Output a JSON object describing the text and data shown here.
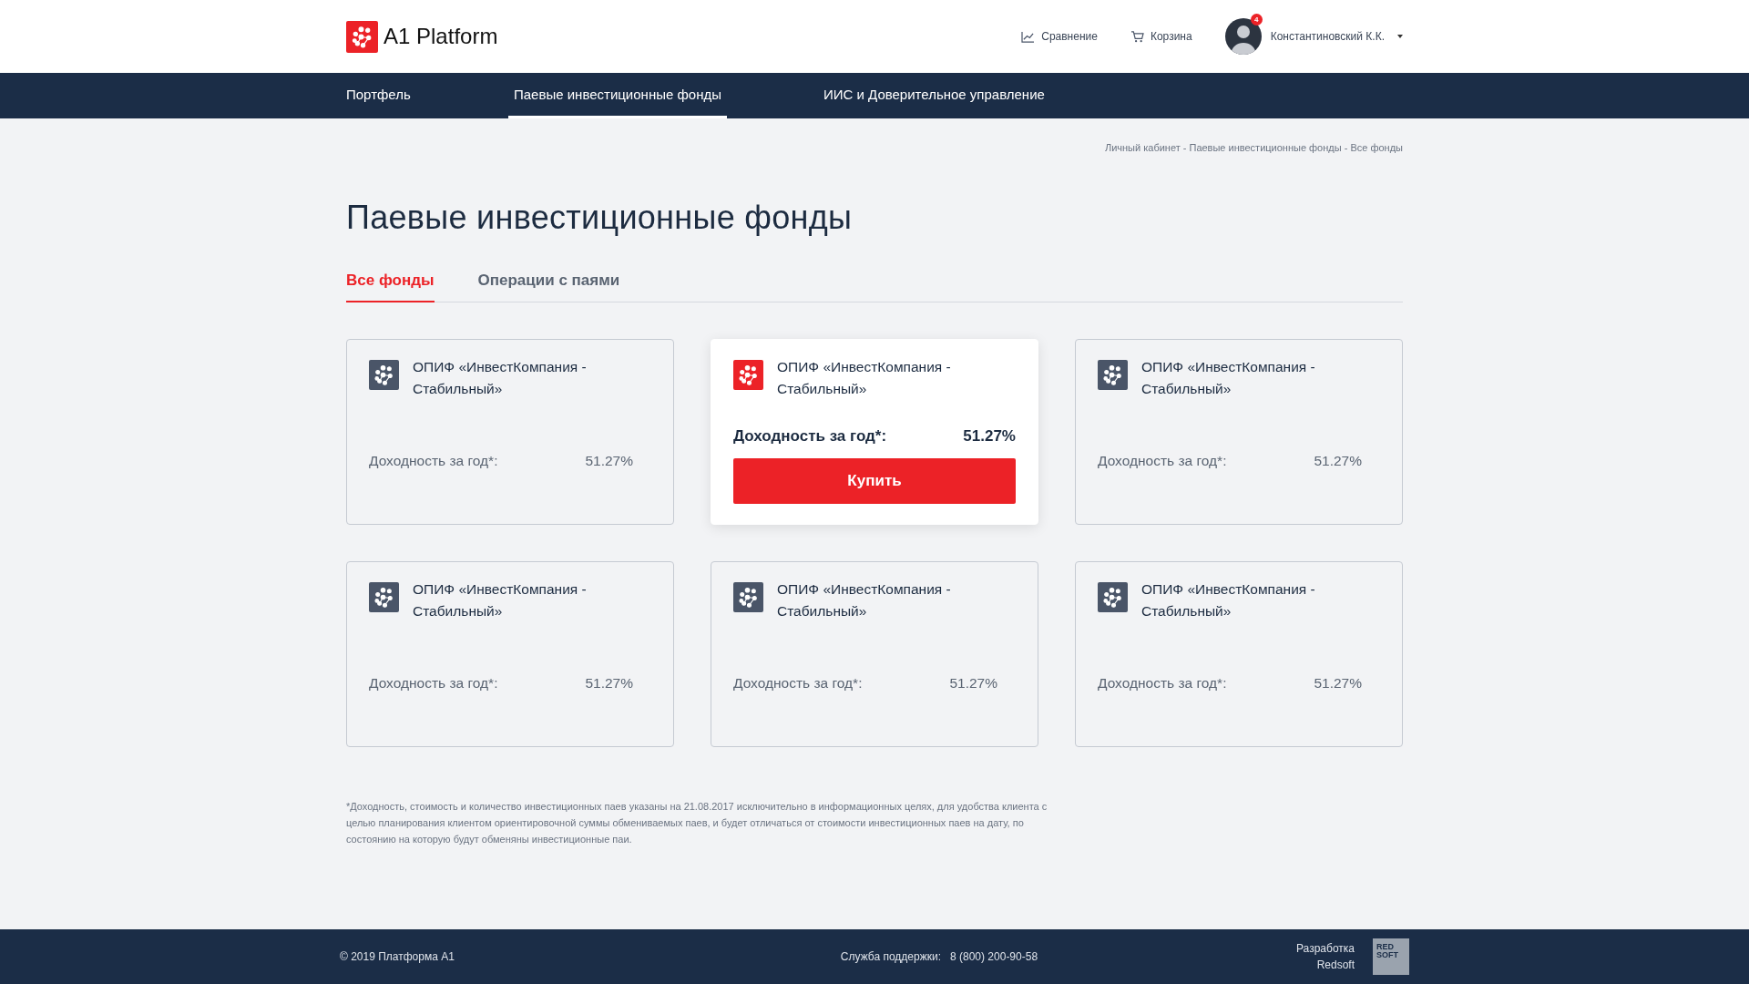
{
  "header": {
    "logo_text": "A1 Platform",
    "links": [
      {
        "kind": "chart",
        "label": "Сравнение"
      },
      {
        "kind": "cart",
        "label": "Корзина"
      }
    ],
    "user": {
      "name": "Константиновский К.К.",
      "badge": "4"
    }
  },
  "nav": [
    {
      "label": "Портфель",
      "selected": false
    },
    {
      "label": "Паевые инвестиционные фонды",
      "selected": true
    },
    {
      "label": "ИИС и Доверительное управление",
      "selected": false
    }
  ],
  "breadcrumb": "Личный кабинет - Паевые инвестиционные фонды - Все фонды",
  "title": "Паевые инвестиционные фонды",
  "tabs": [
    {
      "label": "Все фонды",
      "selected": true
    },
    {
      "label": "Операции с паями",
      "selected": false
    }
  ],
  "cards": [
    {
      "name": "ОПИФ «ИнвестКомпания - Стабильный»",
      "yield_label": "Доходность за год*:",
      "yield": "51.27%",
      "highlighted": false
    },
    {
      "name": "ОПИФ «ИнвестКомпания - Стабильный»",
      "yield_label": "Доходность за год*:",
      "yield": "51.27%",
      "highlighted": true,
      "button": "Купить"
    },
    {
      "name": "ОПИФ «ИнвестКомпания - Стабильный»",
      "yield_label": "Доходность за год*:",
      "yield": "51.27%",
      "highlighted": false
    },
    {
      "name": "ОПИФ «ИнвестКомпания - Стабильный»",
      "yield_label": "Доходность за год*:",
      "yield": "51.27%",
      "highlighted": false
    },
    {
      "name": "ОПИФ «ИнвестКомпания - Стабильный»",
      "yield_label": "Доходность за год*:",
      "yield": "51.27%",
      "highlighted": false
    },
    {
      "name": "ОПИФ «ИнвестКомпания - Стабильный»",
      "yield_label": "Доходность за год*:",
      "yield": "51.27%",
      "highlighted": false
    }
  ],
  "footnote": "*Доходность, стоимость и количество инвестиционных паев указаны на 21.08.2017 исключительно в информационных целях, для удобства клиента с целью планирования клиентом ориентировочной суммы обмениваемых паев, и будет отличаться от стоимости инвестиционных паев на дату, по состоянию на которую будут обменяны инвестиционные паи.",
  "footer": {
    "copyright": "© 2019  Платформа А1",
    "support_label": "Служба поддержки:",
    "support_phone": "8 (800) 200-90-58",
    "developer": [
      "Разработка",
      "Redsoft"
    ],
    "developer_logo": [
      "RED",
      "SOFT"
    ]
  }
}
